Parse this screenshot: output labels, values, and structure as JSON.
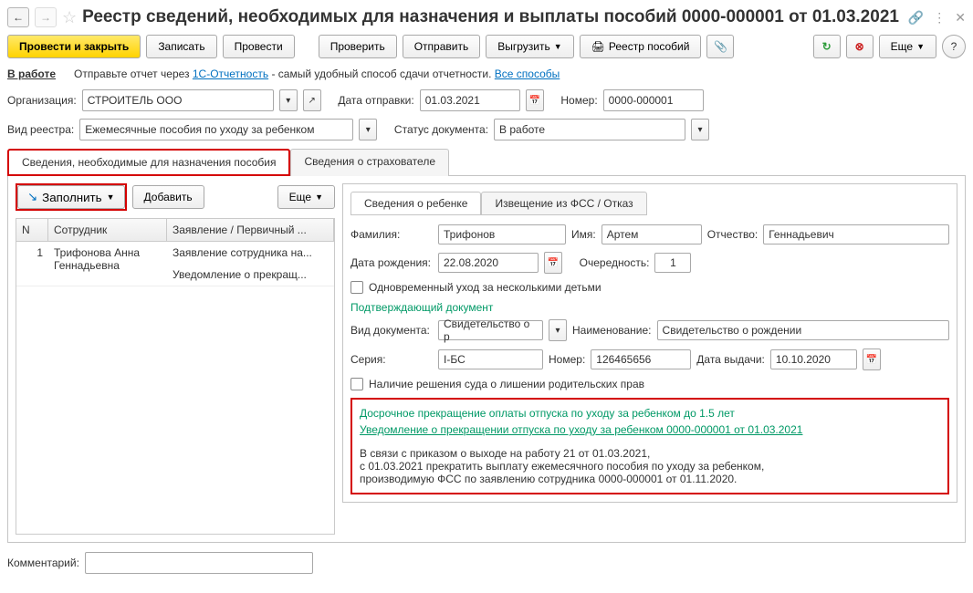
{
  "header": {
    "title": "Реестр сведений, необходимых для назначения и выплаты пособий 0000-000001 от 01.03.2021"
  },
  "toolbar": {
    "post_close": "Провести и закрыть",
    "save": "Записать",
    "post": "Провести",
    "check": "Проверить",
    "send": "Отправить",
    "export": "Выгрузить",
    "registry": "Реестр пособий",
    "more": "Еще"
  },
  "status": {
    "in_work": "В работе",
    "hint_prefix": "Отправьте отчет через ",
    "hint_link": "1С-Отчетность",
    "hint_suffix": " - самый удобный способ сдачи отчетности. ",
    "all_ways": "Все способы"
  },
  "fields": {
    "org_label": "Организация:",
    "org_value": "СТРОИТЕЛЬ ООО",
    "send_date_label": "Дата отправки:",
    "send_date_value": "01.03.2021",
    "number_label": "Номер:",
    "number_value": "0000-000001",
    "type_label": "Вид реестра:",
    "type_value": "Ежемесячные пособия по уходу за ребенком",
    "docstatus_label": "Статус документа:",
    "docstatus_value": "В работе"
  },
  "tabs": {
    "main": "Сведения, необходимые для назначения пособия",
    "insurer": "Сведения о страхователе"
  },
  "left": {
    "fill": "Заполнить",
    "add": "Добавить",
    "more": "Еще",
    "col_n": "N",
    "col_emp": "Сотрудник",
    "col_app": "Заявление / Первичный ...",
    "rows": [
      {
        "n": "1",
        "emp": "Трифонова Анна Геннадьевна",
        "app1": "Заявление сотрудника на...",
        "app2": "Уведомление о прекращ..."
      }
    ]
  },
  "right": {
    "tab_child": "Сведения о ребенке",
    "tab_fss": "Извещение из ФСС / Отказ",
    "surname_label": "Фамилия:",
    "surname": "Трифонов",
    "name_label": "Имя:",
    "name": "Артем",
    "patr_label": "Отчество:",
    "patr": "Геннадьевич",
    "dob_label": "Дата рождения:",
    "dob": "22.08.2020",
    "order_label": "Очередность:",
    "order": "1",
    "simul": "Одновременный уход за несколькими детьми",
    "doc_section": "Подтверждающий документ",
    "doctype_label": "Вид документа:",
    "doctype": "Свидетельство о р",
    "docname_label": "Наименование:",
    "docname": "Свидетельство о рождении",
    "series_label": "Серия:",
    "series": "I-БС",
    "docnum_label": "Номер:",
    "docnum": "126465656",
    "issue_label": "Дата выдачи:",
    "issue": "10.10.2020",
    "court": "Наличие решения суда о лишении родительских прав",
    "term_title": "Досрочное прекращение оплаты отпуска по уходу за ребенком до 1.5 лет",
    "term_link": "Уведомление о прекращении отпуска по уходу за ребенком 0000-000001 от 01.03.2021",
    "term_body1": "В связи с приказом о выходе на работу 21 от 01.03.2021,",
    "term_body2": "с 01.03.2021 прекратить выплату ежемесячного пособия по уходу за ребенком,",
    "term_body3": "производимую ФСС по заявлению сотрудника 0000-000001 от 01.11.2020."
  },
  "comment_label": "Комментарий:"
}
